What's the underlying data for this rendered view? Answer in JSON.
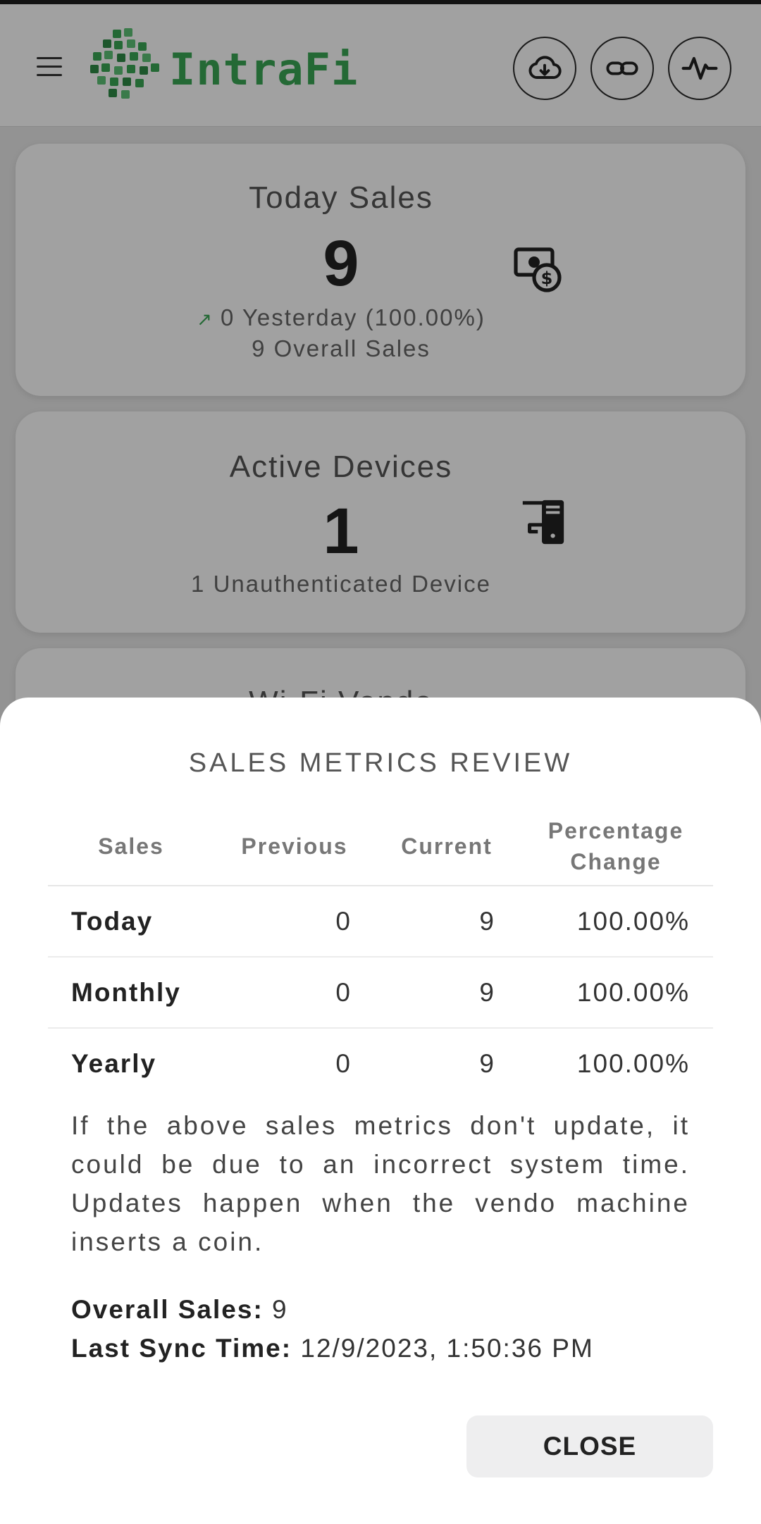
{
  "app": {
    "brand": "IntraFi"
  },
  "header": {
    "icons": [
      "menu-icon",
      "cloud-download-icon",
      "link-icon",
      "activity-icon"
    ]
  },
  "cards": {
    "sales": {
      "title": "Today Sales",
      "value": "9",
      "yesterday": "0 Yesterday (100.00%)",
      "overall": "9 Overall Sales",
      "icon": "money-icon"
    },
    "devices": {
      "title": "Active Devices",
      "value": "1",
      "sub": "1 Unauthenticated Device",
      "icon": "devices-icon"
    },
    "vendo": {
      "title": "Wi-Fi Vendo"
    }
  },
  "sheet": {
    "title": "SALES METRICS REVIEW",
    "columns": {
      "sales": "Sales",
      "previous": "Previous",
      "current": "Current",
      "change": "Percentage Change"
    },
    "rows": [
      {
        "label": "Today",
        "previous": "0",
        "current": "9",
        "change": "100.00%"
      },
      {
        "label": "Monthly",
        "previous": "0",
        "current": "9",
        "change": "100.00%"
      },
      {
        "label": "Yearly",
        "previous": "0",
        "current": "9",
        "change": "100.00%"
      }
    ],
    "note": "If the above sales metrics don't update, it could be due to an incorrect system time. Updates happen when the vendo machine inserts a coin.",
    "overall_label": "Overall Sales:",
    "overall_value": "9",
    "sync_label": "Last Sync Time:",
    "sync_value": "12/9/2023, 1:50:36 PM",
    "close_label": "CLOSE"
  },
  "colors": {
    "brand": "#3aa655",
    "overlay": "#000000",
    "button": "#eeeeef"
  }
}
